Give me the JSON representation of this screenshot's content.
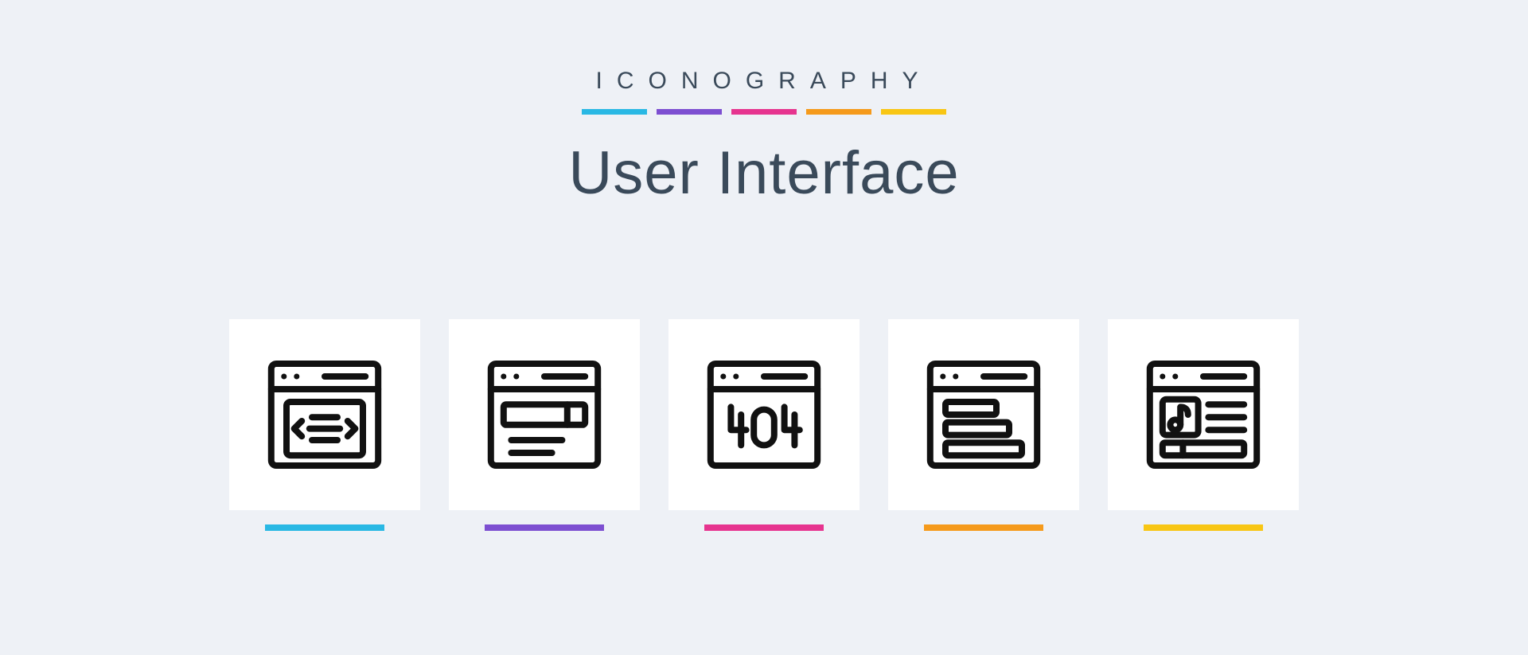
{
  "header": {
    "brand": "ICONOGRAPHY",
    "title": "User Interface"
  },
  "colors": {
    "blue": "#29b8e4",
    "purple": "#7d4fd1",
    "pink": "#e6348f",
    "orange": "#f59a1b",
    "yellow": "#f8c614",
    "card_bg": "#ffffff",
    "page_bg": "#eef1f6",
    "text": "#3a4a5a",
    "stroke": "#111111"
  },
  "icons": [
    {
      "name": "code-window-icon",
      "accent": "blue"
    },
    {
      "name": "search-window-icon",
      "accent": "purple"
    },
    {
      "name": "error-404-window-icon",
      "accent": "pink"
    },
    {
      "name": "list-window-icon",
      "accent": "orange"
    },
    {
      "name": "music-window-icon",
      "accent": "yellow"
    }
  ]
}
